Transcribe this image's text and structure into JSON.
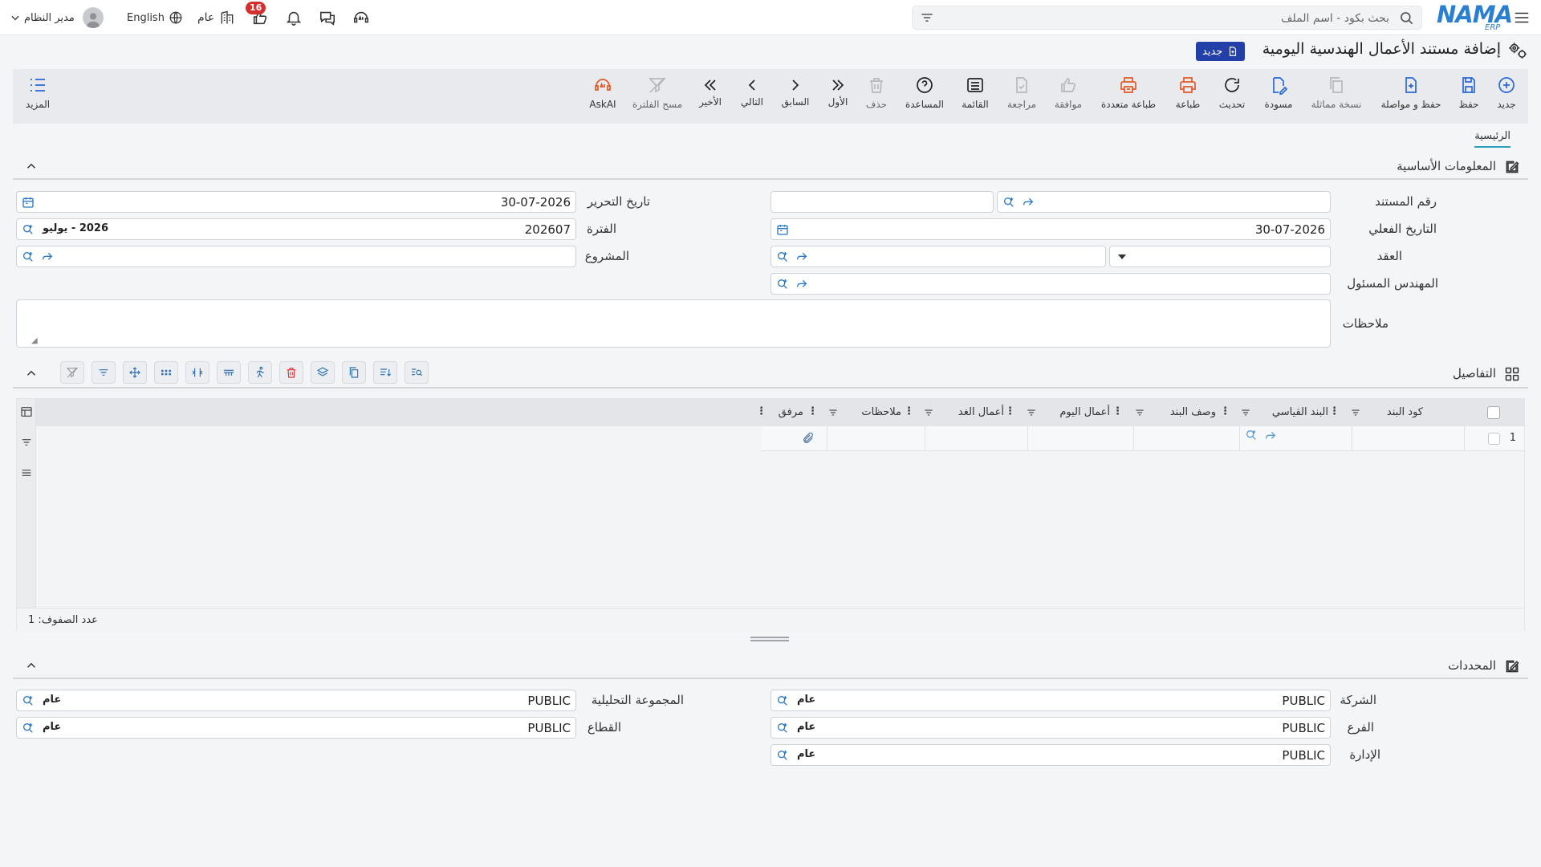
{
  "topbar": {
    "logo_text": "NAMA",
    "logo_sub": "ERP",
    "search_placeholder": "بحث بكود - اسم الملف",
    "user_name": "مدير النظام",
    "language": "English",
    "scope": "عام",
    "notif_count": "16"
  },
  "title": {
    "text": "إضافة مستند الأعمال الهندسية اليومية",
    "badge": "جديد"
  },
  "toolbar": {
    "new": "جديد",
    "save": "حفظ",
    "save_continue": "حفظ و مواصلة",
    "duplicate": "نسخة مماثلة",
    "draft": "مسودة",
    "refresh": "تحديث",
    "print": "طباعة",
    "multi_print": "طباعة متعددة",
    "approve": "موافقة",
    "review": "مراجعة",
    "list": "القائمة",
    "help": "المساعدة",
    "delete": "حذف",
    "first": "الأول",
    "previous": "السابق",
    "next": "التالي",
    "last": "الأخير",
    "clear_filter": "مسح الفلترة",
    "askai": "AskAI",
    "more": "المزيد"
  },
  "tabs": {
    "main": "الرئيسية"
  },
  "basic_info": {
    "section_title": "المعلومات الأساسية",
    "doc_number_label": "رقم المستند",
    "doc_number_value": "",
    "edit_date_label": "تاريخ التحرير",
    "edit_date_value": "30-07-2026",
    "actual_date_label": "التاريخ الفعلي",
    "actual_date_value": "30-07-2026",
    "period_label": "الفترة",
    "period_value": "202607",
    "period_tag": "2026 - يوليو",
    "contract_label": "العقد",
    "project_label": "المشروع",
    "engineer_label": "المهندس المسئول",
    "notes_label": "ملاحظات"
  },
  "details": {
    "section_title": "التفاصيل",
    "columns": [
      "كود البند",
      "البند القياسي",
      "وصف البند",
      "أعمال اليوم",
      "أعمال الغد",
      "ملاحظات",
      "مرفق"
    ],
    "row_number": "1",
    "row_count_label": "عدد الصفوف: 1"
  },
  "dimensions": {
    "section_title": "المحددات",
    "company_label": "الشركة",
    "company_value": "PUBLIC",
    "company_tag": "عام",
    "branch_label": "الفرع",
    "branch_value": "PUBLIC",
    "branch_tag": "عام",
    "department_label": "الإدارة",
    "department_value": "PUBLIC",
    "department_tag": "عام",
    "analytic_label": "المجموعة التحليلية",
    "analytic_value": "PUBLIC",
    "analytic_tag": "عام",
    "sector_label": "القطاع",
    "sector_value": "PUBLIC",
    "sector_tag": "عام"
  },
  "colors": {
    "accent_blue": "#2b68d8",
    "accent_orange": "#e15a28",
    "badge_navy": "#233fa8",
    "badge_red": "#d32f2f"
  }
}
